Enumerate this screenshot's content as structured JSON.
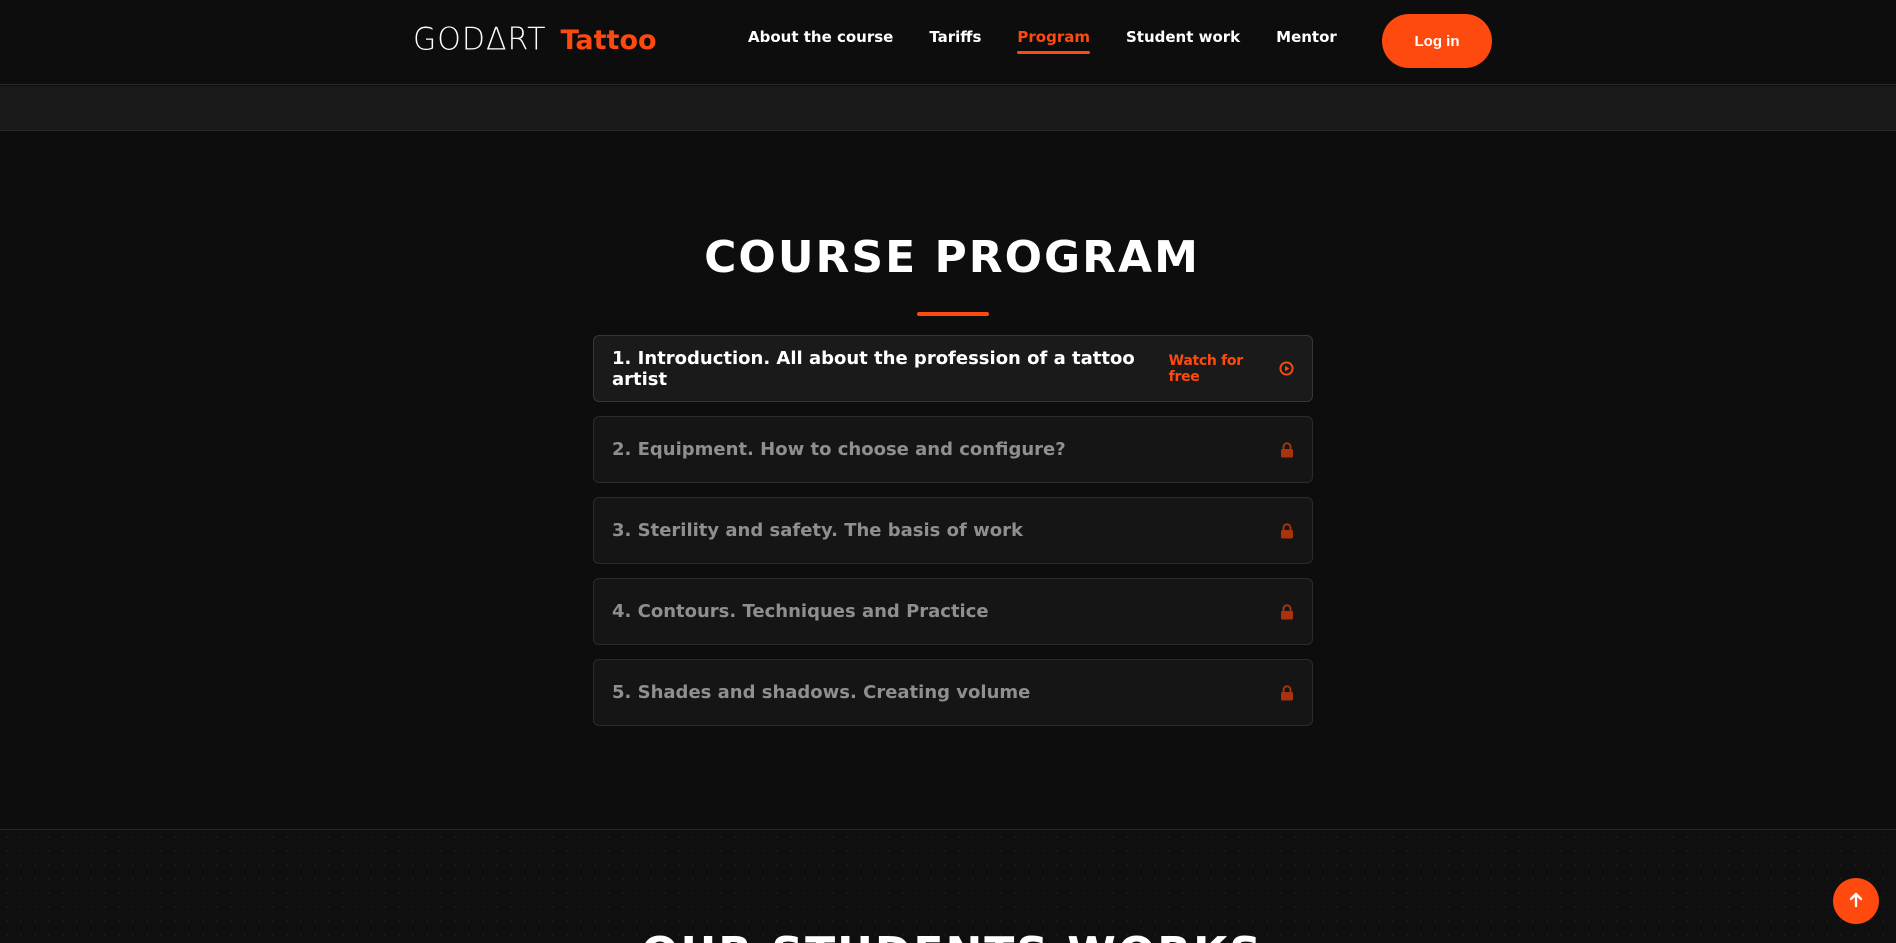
{
  "header": {
    "logo_main": "GODΔRT",
    "logo_sub": "Tattoo",
    "nav": [
      {
        "label": "About the course",
        "active": false
      },
      {
        "label": "Tariffs",
        "active": false
      },
      {
        "label": "Program",
        "active": true
      },
      {
        "label": "Student work",
        "active": false
      },
      {
        "label": "Mentor",
        "active": false
      }
    ],
    "login_label": "Log in"
  },
  "program": {
    "title": "COURSE PROGRAM",
    "items": [
      {
        "label": "1. Introduction. All about the profession of a tattoo artist",
        "action": "Watch for free",
        "icon": "play-circle-icon",
        "locked": false
      },
      {
        "label": "2. Equipment. How to choose and configure?",
        "icon": "lock-icon",
        "locked": true
      },
      {
        "label": "3. Sterility and safety. The basis of work",
        "icon": "lock-icon",
        "locked": true
      },
      {
        "label": "4. Contours. Techniques and Practice",
        "icon": "lock-icon",
        "locked": true
      },
      {
        "label": "5. Shades and shadows. Creating volume",
        "icon": "lock-icon",
        "locked": true
      }
    ]
  },
  "next_section": {
    "title": "OUR STUDENTS WORKS"
  },
  "scroll_top_icon": "arrow-up-icon",
  "colors": {
    "accent": "#ff4a0f",
    "background": "#0d0d0d",
    "band": "#1a1a1a",
    "item_background": "#151515",
    "muted_text": "#8f8f8f"
  }
}
